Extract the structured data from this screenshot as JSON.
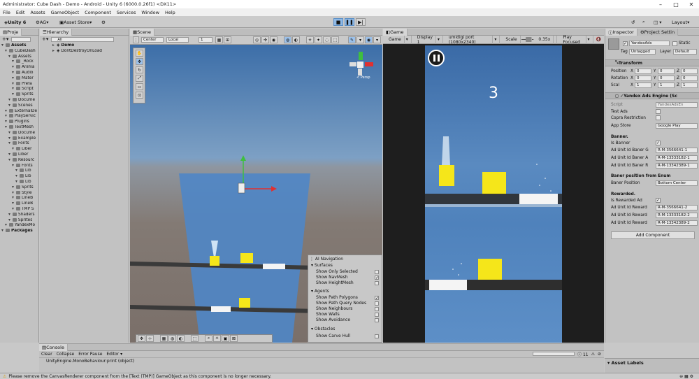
{
  "window": {
    "title": "Administrator: Cube Dash - Demo - Android - Unity 6 (6000.0.26f1) <DX11>"
  },
  "menu": [
    "File",
    "Edit",
    "Assets",
    "GameObject",
    "Component",
    "Services",
    "Window",
    "Help"
  ],
  "toolbar": {
    "unity": "Unity 6",
    "account": "AG",
    "asset_store": "Asset Store",
    "layout": "Layout"
  },
  "project": {
    "tab": "Proje",
    "items": [
      {
        "label": "Assets",
        "indent": 0,
        "bold": true
      },
      {
        "label": "CubeDash",
        "indent": 1
      },
      {
        "label": "Assets",
        "indent": 2
      },
      {
        "label": "_Rock",
        "indent": 3
      },
      {
        "label": "Anima",
        "indent": 3
      },
      {
        "label": "Audio",
        "indent": 3
      },
      {
        "label": "Mater",
        "indent": 3
      },
      {
        "label": "Prefa",
        "indent": 3
      },
      {
        "label": "Script",
        "indent": 3
      },
      {
        "label": "Sprits",
        "indent": 3
      },
      {
        "label": "Docume",
        "indent": 2
      },
      {
        "label": "Scenes",
        "indent": 2
      },
      {
        "label": "ExternalDe",
        "indent": 1
      },
      {
        "label": "PlayServic",
        "indent": 1
      },
      {
        "label": "Plugins",
        "indent": 1
      },
      {
        "label": "TextMesh",
        "indent": 1
      },
      {
        "label": "Docume",
        "indent": 2
      },
      {
        "label": "Example",
        "indent": 2
      },
      {
        "label": "Fonts",
        "indent": 2
      },
      {
        "label": "Liber",
        "indent": 3
      },
      {
        "label": "Liber",
        "indent": 2
      },
      {
        "label": "Resourc",
        "indent": 2
      },
      {
        "label": "Fonts",
        "indent": 3
      },
      {
        "label": "Lib",
        "indent": 4
      },
      {
        "label": "Lib",
        "indent": 4
      },
      {
        "label": "Lib",
        "indent": 4
      },
      {
        "label": "Sprits",
        "indent": 3
      },
      {
        "label": "Style",
        "indent": 3
      },
      {
        "label": "LineB",
        "indent": 3
      },
      {
        "label": "LineB",
        "indent": 3
      },
      {
        "label": "TMP S",
        "indent": 3
      },
      {
        "label": "Shaders",
        "indent": 2
      },
      {
        "label": "Sprites",
        "indent": 2
      },
      {
        "label": "YandexMo",
        "indent": 1
      },
      {
        "label": "Packages",
        "indent": 0,
        "bold": true
      }
    ]
  },
  "hierarchy": {
    "tab": "Hierarchy",
    "search": "All",
    "items": [
      "Demo",
      "DontDestroyOnLoad"
    ]
  },
  "scene": {
    "tab": "Scene",
    "pivot": "Center",
    "space": "Local",
    "snap": "1",
    "persp": "< Persp"
  },
  "ainav": {
    "title": "AI Navigation",
    "sections": [
      {
        "label": "Surfaces",
        "items": [
          {
            "label": "Show Only Selected",
            "on": false
          },
          {
            "label": "Show NavMesh",
            "on": true
          },
          {
            "label": "Show HeightMesh",
            "on": false
          }
        ]
      },
      {
        "label": "Agents",
        "items": [
          {
            "label": "Show Path Polygons",
            "on": true
          },
          {
            "label": "Show Path Query Nodes",
            "on": false
          },
          {
            "label": "Show Neighbours",
            "on": false
          },
          {
            "label": "Show Walls",
            "on": false
          },
          {
            "label": "Show Avoidance",
            "on": false
          }
        ]
      },
      {
        "label": "Obstacles",
        "items": [
          {
            "label": "Show Carve Hull",
            "on": false
          }
        ]
      }
    ]
  },
  "game": {
    "tab": "Game",
    "mode": "Game",
    "display": "Display 1",
    "resolution": "umidigi port (1080x2340)",
    "scale_label": "Scale",
    "scale": "0.35x",
    "play_mode": "Play Focused",
    "score": "3"
  },
  "inspector": {
    "tabs": [
      "Inspector",
      "Project Settin"
    ],
    "object_name": "YandexAds",
    "static": "Static",
    "tag_label": "Tag",
    "tag": "Untagged",
    "layer_label": "Layer",
    "layer": "Default",
    "transform": {
      "title": "Transform",
      "rows": [
        {
          "label": "Position",
          "x": "0",
          "y": "0",
          "z": "0"
        },
        {
          "label": "Rotation",
          "x": "0",
          "y": "0",
          "z": "0"
        },
        {
          "label": "Scal",
          "x": "1",
          "y": "1",
          "z": "1"
        }
      ]
    },
    "component": {
      "title": "Yandex Ads Engine (Sc",
      "script_label": "Script",
      "script": "YandexAdsEn",
      "test_ads": "Test Ads",
      "copra": "Copra Restriction",
      "app_store_label": "App Store",
      "app_store": "Google Play",
      "banner_header": "Banner.",
      "is_banner": "Is Banner",
      "banner_ids": [
        {
          "label": "Ad Unit Id Baner G",
          "value": "R-M-3566641-1"
        },
        {
          "label": "Ad Unit Id Baner A",
          "value": "R-M-13333182-1"
        },
        {
          "label": "Ad Unit Id Baner R",
          "value": "R-M-13342389-1"
        }
      ],
      "enum_header": "Baner position from Enum",
      "pos_label": "Baner Position",
      "pos": "Bottom Center",
      "rewarded_header": "Rewarded.",
      "is_rewarded": "Is Rewarded Ad",
      "reward_ids": [
        {
          "label": "Ad Unit Id Reward",
          "value": "R-M-3566641-2"
        },
        {
          "label": "Ad Unit Id Reward",
          "value": "R-M-13333182-2"
        },
        {
          "label": "Ad Unit Id Reward",
          "value": "R-M-13342389-2"
        }
      ],
      "add_component": "Add Component"
    }
  },
  "console": {
    "tab": "Console",
    "clear": "Clear",
    "collapse": "Collapse",
    "error_pause": "Error Pause",
    "editor": "Editor",
    "count": "11",
    "line": "UnityEngine.MonoBehaviour:print (object)"
  },
  "asset_labels": "Asset Labels",
  "status": "Please remove the CanvasRenderer component from the [Text (TMP)] GameObject as this component is no longer necessary."
}
